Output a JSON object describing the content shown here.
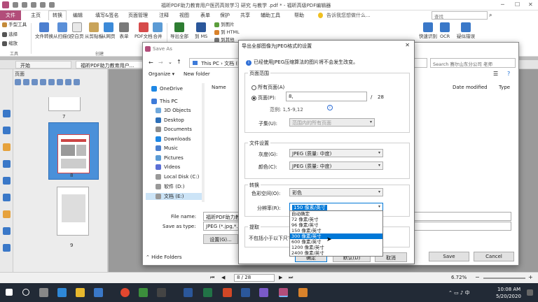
{
  "app": {
    "window_title": "福昕PDF助力教育用户医药高效学习 研究 与教学 .pdf * - 福昕高级PDF编辑器",
    "window_search_placeholder": "查找",
    "tell_me": "告诉我您想做什么..."
  },
  "ribbon_tabs": [
    "文件",
    "主页",
    "转换",
    "编辑",
    "填写&签名",
    "页面管理",
    "注释",
    "视图",
    "表单",
    "保护",
    "共享",
    "辅助工具",
    "帮助"
  ],
  "ribbon_left": {
    "hand": "手型工具",
    "select": "选择",
    "zoom": "缩放",
    "group": "工具"
  },
  "ribbon_buttons": [
    {
      "label": "文件转换"
    },
    {
      "label": "从扫描仪"
    },
    {
      "label": "空白页"
    },
    {
      "label": "从剪贴板"
    },
    {
      "label": "从网页"
    },
    {
      "label": "表单"
    },
    {
      "label": "PDF文档"
    },
    {
      "label": "合并"
    },
    {
      "label": "导出全部"
    },
    {
      "label": "到 MS"
    },
    {
      "label": "到图片"
    },
    {
      "label": "到 HTML"
    },
    {
      "label": "到其他"
    },
    {
      "label": "快速识别"
    },
    {
      "label": "OCR"
    },
    {
      "label": "疑似错误"
    }
  ],
  "ribbon_group_create": "创建",
  "doc_tabs": [
    "开始",
    "福昕PDF助力教育用户..."
  ],
  "pages_panel": {
    "title": "页面",
    "pages": [
      "7",
      "8",
      "9"
    ]
  },
  "saveas": {
    "caption": "Save As",
    "address": [
      "This PC",
      "文档 (E:)"
    ],
    "search": "Search 赛尔山东分公司 老师",
    "organize": "Organize ▾",
    "new_folder": "New folder",
    "col_name": "Name",
    "col_date": "Date modified",
    "col_type": "Type",
    "tree": [
      "OneDrive",
      "This PC",
      "3D Objects",
      "Desktop",
      "Documents",
      "Downloads",
      "Music",
      "Pictures",
      "Videos",
      "Local Disk (C:)",
      "软件 (D:)",
      "文档 (E:)"
    ],
    "file_name_label": "File name:",
    "file_name_value": "福昕PDF助力教育用户医药高效学习 研究与教学.jpg",
    "save_type_label": "Save as type:",
    "save_type_value": "JPEG (*.jpg,*.jpeg,*.jpe)",
    "settings_button": "设置(G)...",
    "hide_folders": "Hide Folders",
    "save_button": "Save",
    "cancel_button": "Cancel"
  },
  "export": {
    "title": "导出全部图像为JPEG格式的设置",
    "info": "已经使用JPEG压缩算法的图片将不会发生改变。",
    "page_range": "页面范围",
    "all_pages": "所有页面(A)",
    "pages_opt": "页面(P):",
    "pages_value": "8,",
    "pages_total": "28",
    "range_hint": "范例: 1,5-9,12",
    "subset_label": "子集(U):",
    "subset_value": "范围内的所有页面",
    "file_settings": "文件设置",
    "gray_label": "灰度(G):",
    "gray_value": "JPEG (质量: 中度)",
    "color_label": "颜色(C):",
    "color_value": "JPEG (质量: 中度)",
    "convert": "转换",
    "colorspace_label": "色彩空间(O):",
    "colorspace_value": "彩色",
    "resolution_label": "分辨率(R):",
    "resolution_value": "150 像素/英寸",
    "extract": "提取",
    "extract_text": "不包括小于以下尺寸的",
    "ok": "确定",
    "defaults": "默认(D)",
    "cancel": "取消"
  },
  "resolution_options": [
    "自动确定",
    "72 像素/英寸",
    "96 像素/英寸",
    "150 像素/英寸",
    "300 像素/英寸",
    "600 像素/英寸",
    "1200 像素/英寸",
    "2400 像素/英寸"
  ],
  "resolution_highlighted": "300 像素/英寸",
  "statusbar": {
    "page": "8 / 28",
    "zoom": "6.72%"
  },
  "taskbar": {
    "time": "10:08 AM",
    "date": "5/20/2020"
  },
  "colors": {
    "accent": "#b24d7a",
    "selection": "#0078d7",
    "page_selected": "#4a90d9"
  }
}
